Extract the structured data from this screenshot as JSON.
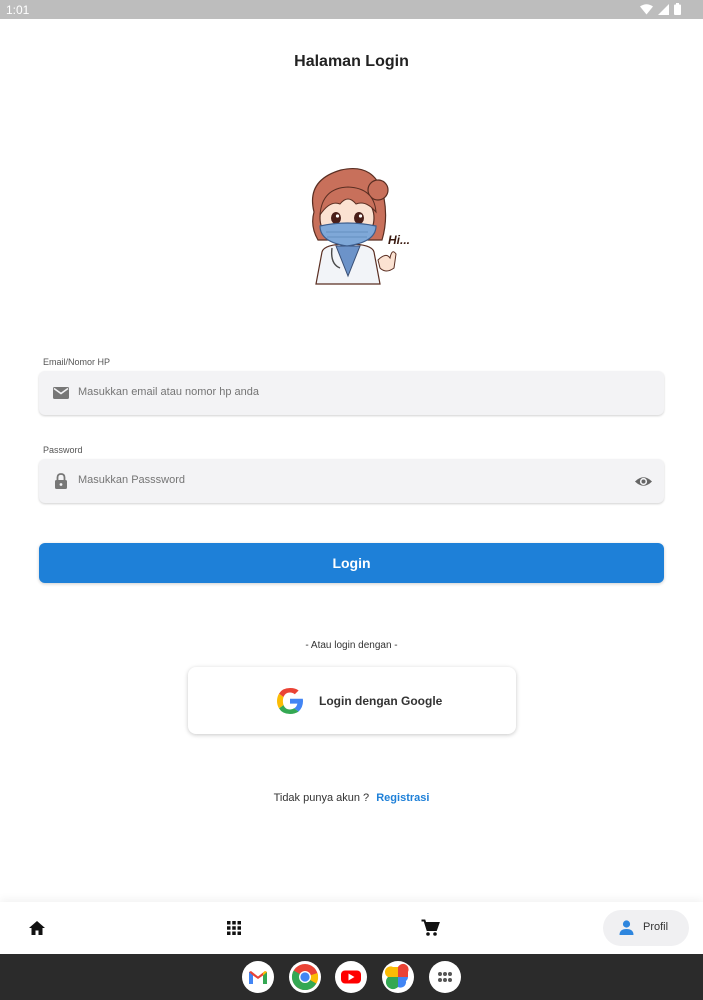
{
  "status_bar": {
    "time": "1:01"
  },
  "page": {
    "title": "Halaman Login"
  },
  "illustration": {
    "greeting": "Hi..."
  },
  "email_field": {
    "label": "Email/Nomor HP",
    "placeholder": "Masukkan email atau nomor hp anda",
    "value": ""
  },
  "password_field": {
    "label": "Password",
    "placeholder": "Masukkan Passsword",
    "value": ""
  },
  "login_button": {
    "label": "Login"
  },
  "alternative": {
    "text": "- Atau login dengan -"
  },
  "google_button": {
    "label": "Login dengan Google"
  },
  "register": {
    "prompt": "Tidak punya akun ?",
    "link_label": "Registrasi"
  },
  "bottom_nav": {
    "items": [
      {
        "icon": "home-icon"
      },
      {
        "icon": "grid-icon"
      },
      {
        "icon": "cart-icon"
      },
      {
        "icon": "person-icon",
        "label": "Profil",
        "active": true
      }
    ]
  },
  "dock": {
    "apps": [
      "gmail-icon",
      "chrome-icon",
      "youtube-icon",
      "photos-icon",
      "app-drawer-icon"
    ]
  },
  "colors": {
    "primary": "#1e80d8",
    "field_bg": "#f3f3f5",
    "status_bar": "#bdbdbd",
    "dock": "#2b2b2b",
    "text": "#222222"
  }
}
